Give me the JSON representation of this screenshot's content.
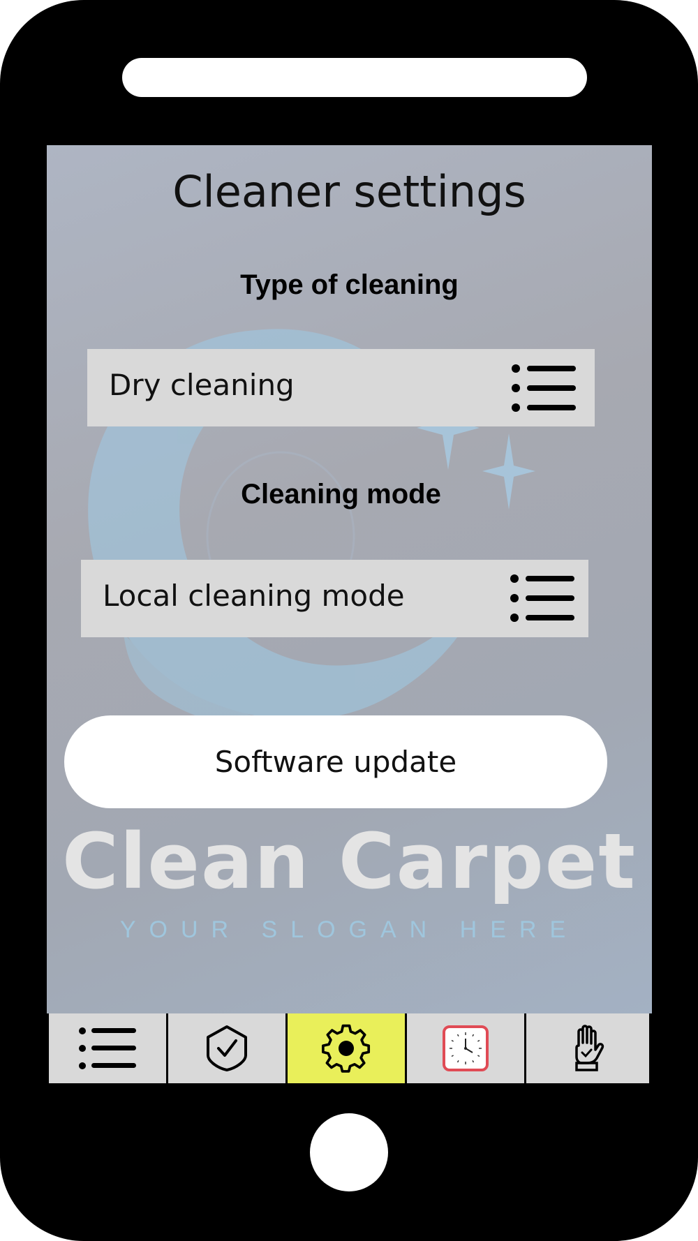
{
  "screen": {
    "title": "Cleaner settings",
    "type_section": {
      "label": "Type of cleaning",
      "selected": "Dry cleaning"
    },
    "mode_section": {
      "label": "Cleaning mode",
      "selected": "Local cleaning mode"
    },
    "update_button": "Software update",
    "brand": {
      "name": "Clean Carpet",
      "slogan": "YOUR SLOGAN HERE"
    }
  },
  "navbar": {
    "items": [
      {
        "icon": "list-icon",
        "active": false
      },
      {
        "icon": "shield-check-icon",
        "active": false
      },
      {
        "icon": "gear-icon",
        "active": true
      },
      {
        "icon": "clock-icon",
        "active": false
      },
      {
        "icon": "glove-icon",
        "active": false
      }
    ]
  },
  "colors": {
    "active_tab": "#e9ef5a",
    "clock_accent": "#e04b55",
    "slogan": "#9fc6dd",
    "logo_blue": "#9ecbe6"
  }
}
